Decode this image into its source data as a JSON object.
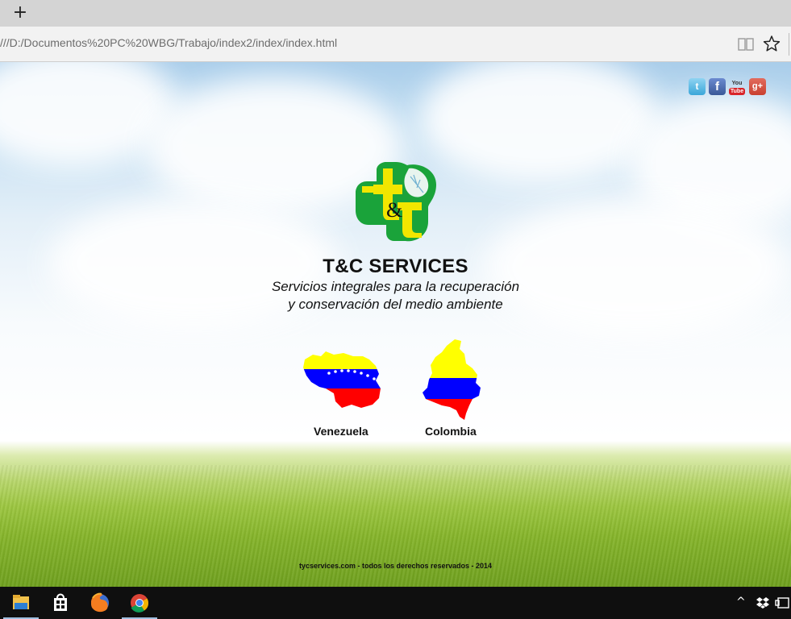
{
  "browser": {
    "new_tab_glyph": "+",
    "url": "///D:/Documentos%20PC%20WBG/Trabajo/index2/index/index.html",
    "icons": [
      "reading-view-icon",
      "favorite-star-icon"
    ]
  },
  "page": {
    "social": {
      "twitter_glyph": "t",
      "facebook_glyph": "f",
      "youtube_top": "You",
      "youtube_bottom": "Tube",
      "googleplus_glyph": "g+"
    },
    "logo_text": "&",
    "title": "T&C SERVICES",
    "tagline_line1": "Servicios integrales para la recuperación",
    "tagline_line2": "y conservación del medio ambiente",
    "countries": [
      {
        "label": "Venezuela",
        "flag_colors": [
          "#ffff00",
          "#0000ff",
          "#ff0000"
        ]
      },
      {
        "label": "Colombia",
        "flag_colors": [
          "#ffff00",
          "#0000ff",
          "#ff0000"
        ]
      }
    ],
    "footer": "tycservices.com - todos los derechos reservados - 2014",
    "colors": {
      "logo_green": "#1aa33a",
      "logo_yellow": "#f2e600",
      "sky": "#a9cdea",
      "grass": "#86b52b"
    }
  },
  "taskbar": {
    "apps": [
      "file-explorer-icon",
      "windows-store-icon",
      "firefox-icon",
      "chrome-icon"
    ],
    "tray": {
      "chevron": "^"
    }
  }
}
